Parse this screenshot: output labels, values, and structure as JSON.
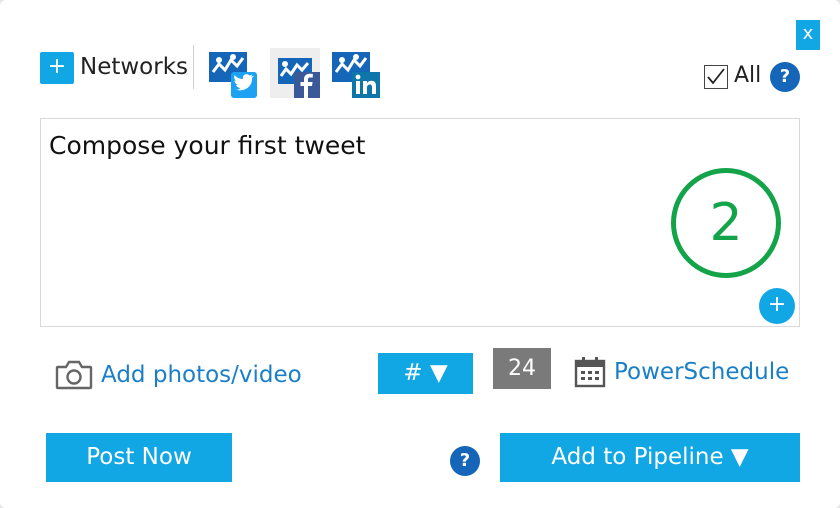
{
  "dialog": {
    "close_label": "x"
  },
  "networks": {
    "add_symbol": "+",
    "label": "Networks",
    "accounts": [
      {
        "network": "twitter",
        "icon": "twitter-account-icon",
        "badge": "t"
      },
      {
        "network": "facebook",
        "icon": "facebook-account-icon",
        "badge": "f"
      },
      {
        "network": "linkedin",
        "icon": "linkedin-account-icon",
        "badge": "in"
      }
    ],
    "all_label": "All",
    "all_checked": true,
    "help_symbol": "?"
  },
  "composer": {
    "text": "Compose your first tweet",
    "step_number": "2",
    "add_symbol": "+"
  },
  "toolbar": {
    "add_media_label": "Add photos/video",
    "hashtag_label": "# ▼",
    "char_count": "24",
    "schedule_label": "PowerSchedule"
  },
  "footer": {
    "post_now_label": "Post Now",
    "help_symbol": "?",
    "pipeline_label": "Add to Pipeline ▼"
  },
  "colors": {
    "accent": "#11a6e4",
    "help": "#1565b8",
    "step": "#13a349",
    "link": "#1a7fc7",
    "counter": "#7a7a7a"
  }
}
